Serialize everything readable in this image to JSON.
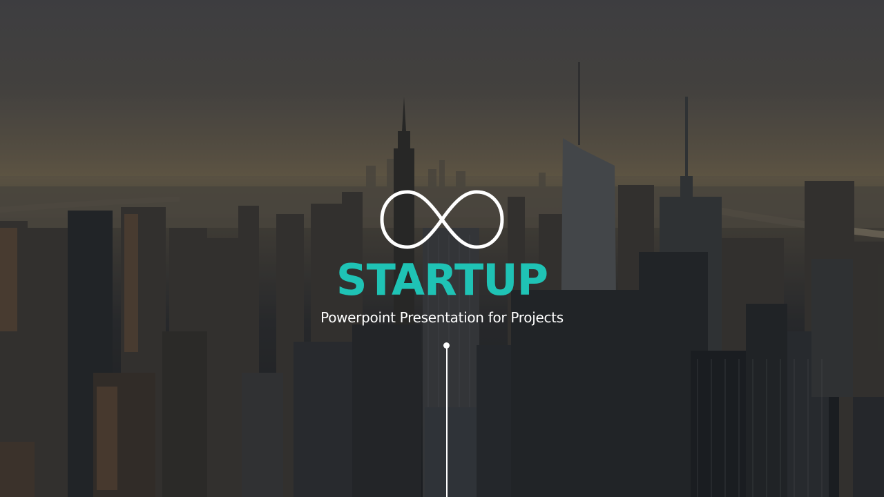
{
  "slide": {
    "title": "STARTUP",
    "subtitle": "Powerpoint Presentation for Projects",
    "logo_icon": "infinity-icon",
    "background_image": "city-skyline-photo"
  },
  "colors": {
    "accent": "#1fc3b5",
    "text": "#ffffff",
    "logo_stroke": "#ffffff"
  }
}
